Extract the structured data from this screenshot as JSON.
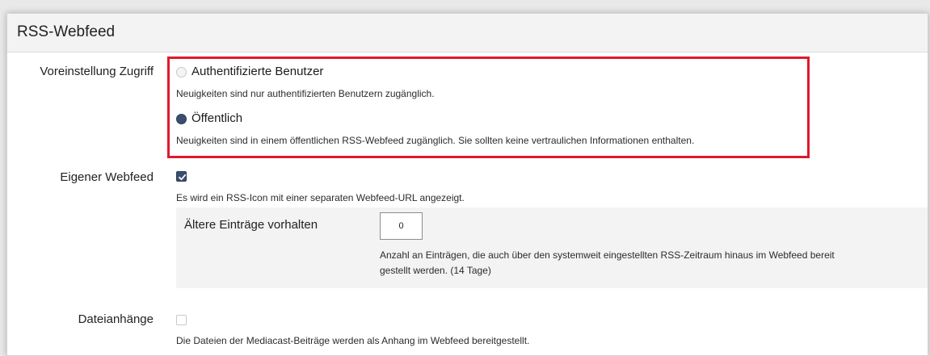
{
  "section": {
    "title": "RSS-Webfeed"
  },
  "access": {
    "label": "Voreinstellung Zugriff",
    "options": [
      {
        "label": "Authentifizierte Benutzer",
        "info": "Neuigkeiten sind nur authentifizierten Benutzern zugänglich.",
        "selected": false
      },
      {
        "label": "Öffentlich",
        "info": "Neuigkeiten sind in einem öffentlichen RSS-Webfeed zugänglich. Sie sollten keine vertraulichen Informationen enthalten.",
        "selected": true
      }
    ]
  },
  "own_feed": {
    "label": "Eigener Webfeed",
    "checked": true,
    "info": "Es wird ein RSS-Icon mit einer separaten Webfeed-URL angezeigt.",
    "older_entries": {
      "label": "Ältere Einträge vorhalten",
      "value": "0",
      "info_line1": "Anzahl an Einträgen, die auch über den systemweit eingestellten RSS-Zeitraum hinaus im Webfeed bereit",
      "info_line2": "gestellt werden. (14 Tage)"
    }
  },
  "attachments": {
    "label": "Dateianhänge",
    "checked": false,
    "info": "Die Dateien der Mediacast-Beiträge werden als Anhang im Webfeed bereitgestellt."
  },
  "colors": {
    "highlight": "#e0182d",
    "accent": "#3b4e6e"
  }
}
